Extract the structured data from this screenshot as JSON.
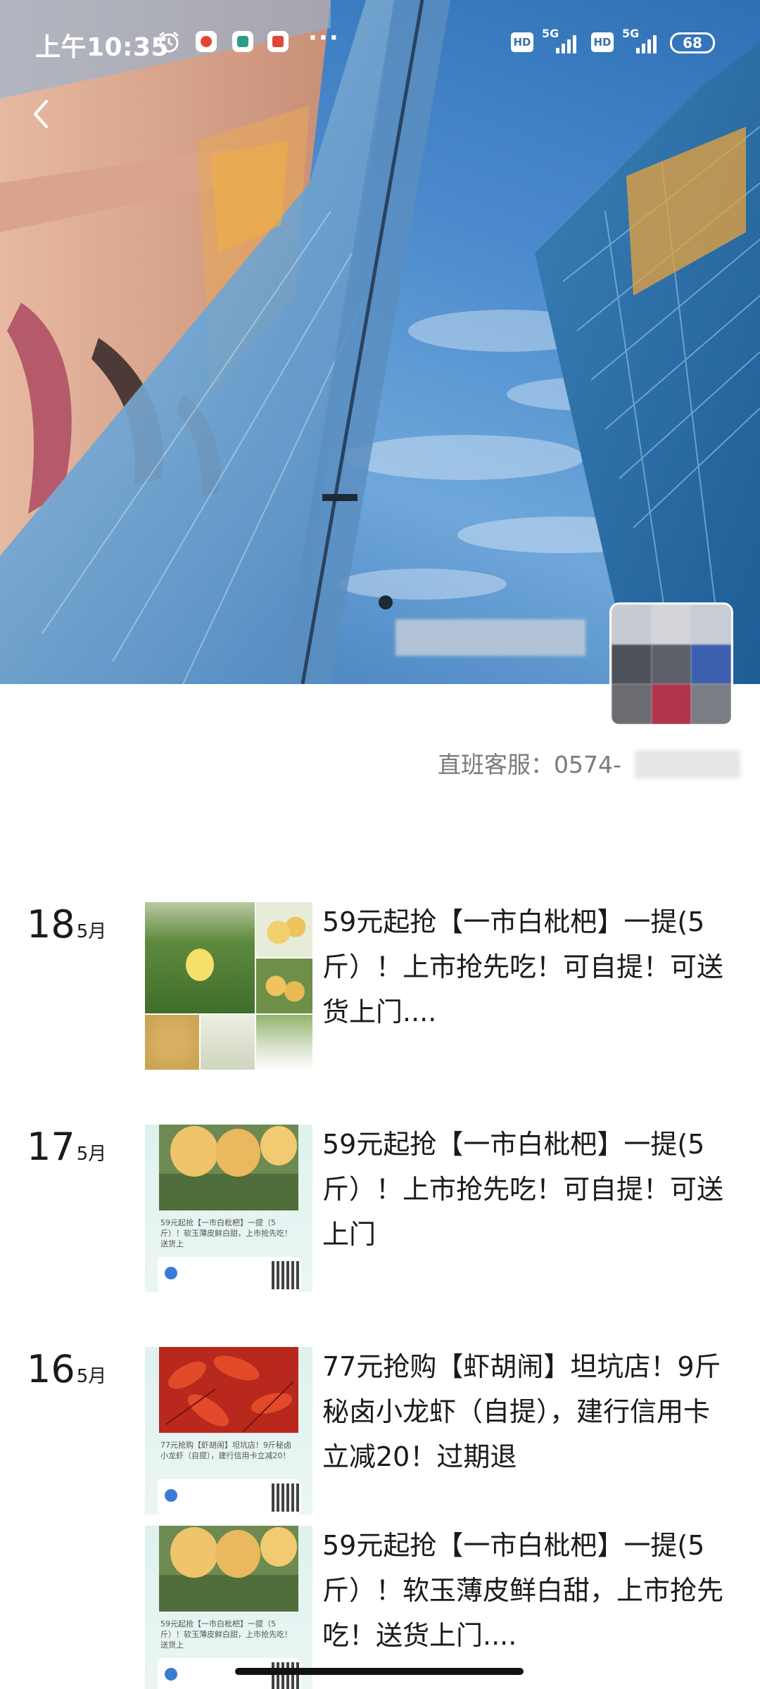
{
  "status_bar": {
    "time": "上午10:35",
    "more": "···",
    "hd1": "HD",
    "net1": "5G",
    "hd2": "HD",
    "net2": "5G",
    "battery": "68"
  },
  "profile": {
    "service_label": "直班客服：0574-"
  },
  "feed": [
    {
      "day": "18",
      "month": "5月",
      "caption": "59元起抢【一市白枇杷】一提(5斤）！上市抢先吃！可自提！可送货上门...."
    },
    {
      "day": "17",
      "month": "5月",
      "caption": "59元起抢【一市白枇杷】一提(5斤）！上市抢先吃！可自提！可送上门",
      "thumb_text": "59元起抢【一市白枇杷】一提（5斤）！软玉薄皮鲜白甜，上市抢先吃！送货上"
    },
    {
      "day": "16",
      "month": "5月",
      "caption": "77元抢购【虾胡闹】坦坑店！9斤秘卤小龙虾（自提），建行信用卡立减20！过期退",
      "thumb_text": "77元抢购【虾胡闹】坦坑店！9斤秘卤小龙虾（自提），建行信用卡立减20！"
    },
    {
      "caption": "59元起抢【一市白枇杷】一提(5斤）！软玉薄皮鲜白甜，上市抢先吃！送货上门....",
      "thumb_text": "59元起抢【一市白枇杷】一提（5斤）！软玉薄皮鲜白甜，上市抢先吃！送货上"
    }
  ],
  "colors": {
    "sky": "#4b8bcd",
    "text": "#1a1a1a",
    "muted": "#7a7a7a"
  }
}
